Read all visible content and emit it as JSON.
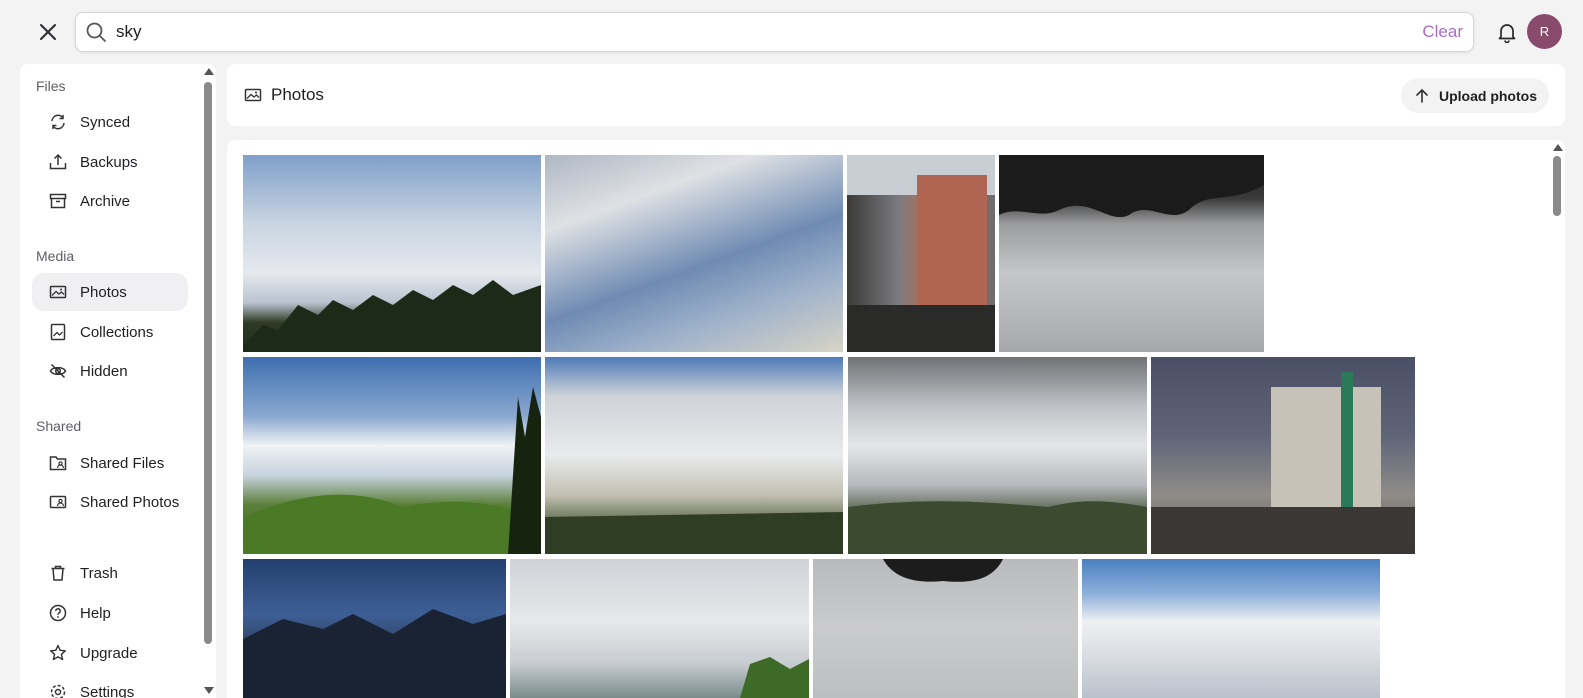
{
  "search": {
    "value": "sky",
    "clear_label": "Clear"
  },
  "avatar": {
    "initial": "R",
    "color": "#884b6b"
  },
  "sidebar": {
    "sections": [
      {
        "heading": "Files",
        "items": [
          {
            "label": "Synced",
            "icon": "sync-icon"
          },
          {
            "label": "Backups",
            "icon": "upload-tray-icon"
          },
          {
            "label": "Archive",
            "icon": "archive-box-icon"
          }
        ]
      },
      {
        "heading": "Media",
        "items": [
          {
            "label": "Photos",
            "icon": "photos-icon",
            "active": true
          },
          {
            "label": "Collections",
            "icon": "collections-icon"
          },
          {
            "label": "Hidden",
            "icon": "eye-off-icon"
          }
        ]
      },
      {
        "heading": "Shared",
        "items": [
          {
            "label": "Shared Files",
            "icon": "shared-folder-icon"
          },
          {
            "label": "Shared Photos",
            "icon": "shared-photos-icon"
          }
        ]
      }
    ],
    "bottom": [
      {
        "label": "Trash",
        "icon": "trash-icon"
      },
      {
        "label": "Help",
        "icon": "help-circle-icon"
      },
      {
        "label": "Upgrade",
        "icon": "star-icon"
      },
      {
        "label": "Settings",
        "icon": "gear-icon"
      }
    ]
  },
  "main": {
    "title": "Photos",
    "upload_label": "Upload photos"
  },
  "photos": [
    {
      "name": "sky-forest-clouds"
    },
    {
      "name": "wispy-cirrus-sky"
    },
    {
      "name": "city-buildings-sky"
    },
    {
      "name": "tree-silhouette-overcast"
    },
    {
      "name": "green-hills-clouds"
    },
    {
      "name": "mountain-valley-clouds"
    },
    {
      "name": "storm-clouds-plain"
    },
    {
      "name": "construction-crane-dusk"
    },
    {
      "name": "blue-mountains-town"
    },
    {
      "name": "pale-sky-treeline"
    },
    {
      "name": "hazy-sky-branches"
    },
    {
      "name": "cumulus-blue-sky"
    }
  ],
  "colors": {
    "accent": "#a86ec7",
    "active_bg": "#f0f0f2"
  }
}
